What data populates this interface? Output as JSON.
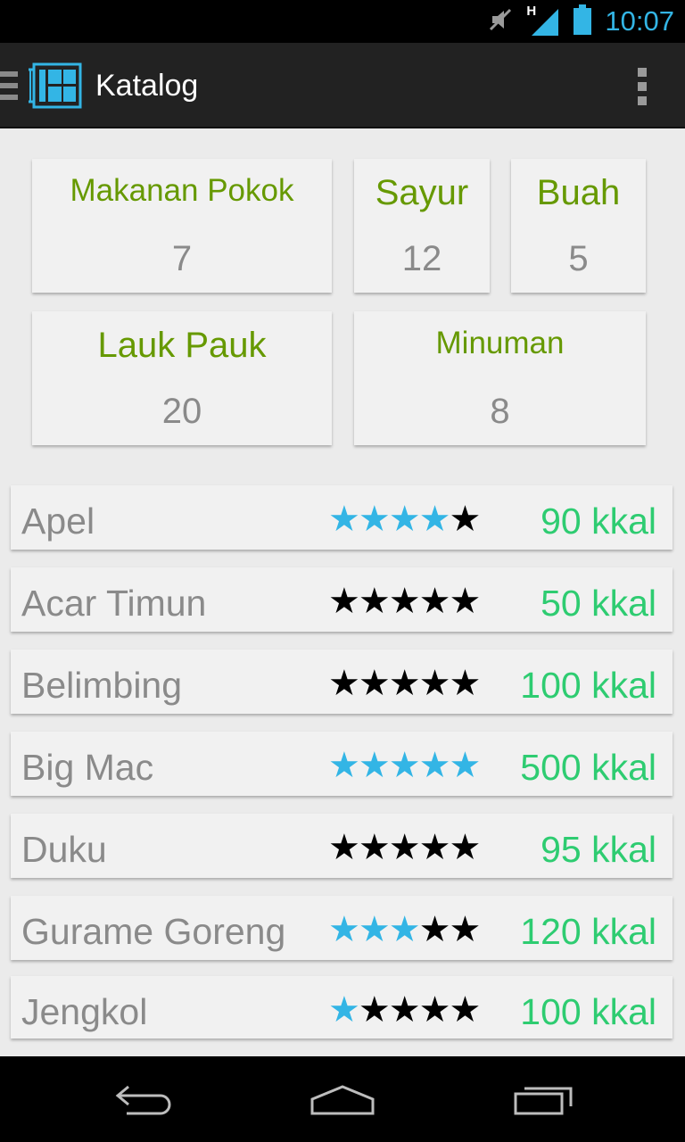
{
  "status_bar": {
    "time": "10:07",
    "network_type": "H",
    "icons": [
      "mute-icon",
      "signal-icon",
      "battery-icon"
    ],
    "accent_color": "#33b5e5"
  },
  "action_bar": {
    "title": "Katalog",
    "app_icon": "catalog-icon",
    "menu_icon": "overflow-menu-icon",
    "drawer_icon": "drawer-indicator-icon"
  },
  "categories": [
    {
      "name": "Makanan Pokok",
      "count": "7"
    },
    {
      "name": "Sayur",
      "count": "12"
    },
    {
      "name": "Buah",
      "count": "5"
    },
    {
      "name": "Lauk Pauk",
      "count": "20"
    },
    {
      "name": "Minuman",
      "count": "8"
    }
  ],
  "foods": [
    {
      "name": "Apel",
      "rating": 4,
      "max_rating": 5,
      "calories": "90 kkal"
    },
    {
      "name": "Acar Timun",
      "rating": 0,
      "max_rating": 5,
      "calories": "50 kkal"
    },
    {
      "name": "Belimbing",
      "rating": 0,
      "max_rating": 5,
      "calories": "100 kkal"
    },
    {
      "name": "Big Mac",
      "rating": 5,
      "max_rating": 5,
      "calories": "500 kkal"
    },
    {
      "name": "Duku",
      "rating": 0,
      "max_rating": 5,
      "calories": "95 kkal"
    },
    {
      "name": "Gurame Goreng",
      "rating": 3,
      "max_rating": 5,
      "calories": "120 kkal"
    },
    {
      "name": "Jengkol",
      "rating": 1,
      "max_rating": 5,
      "calories": "100 kkal"
    }
  ],
  "nav_bar": {
    "buttons": [
      "back-icon",
      "home-icon",
      "recent-apps-icon"
    ]
  },
  "colors": {
    "category_name": "#669900",
    "count": "#8a8a8a",
    "star_filled": "#33b5e5",
    "star_empty": "#000000",
    "calories": "#2ecc71"
  }
}
